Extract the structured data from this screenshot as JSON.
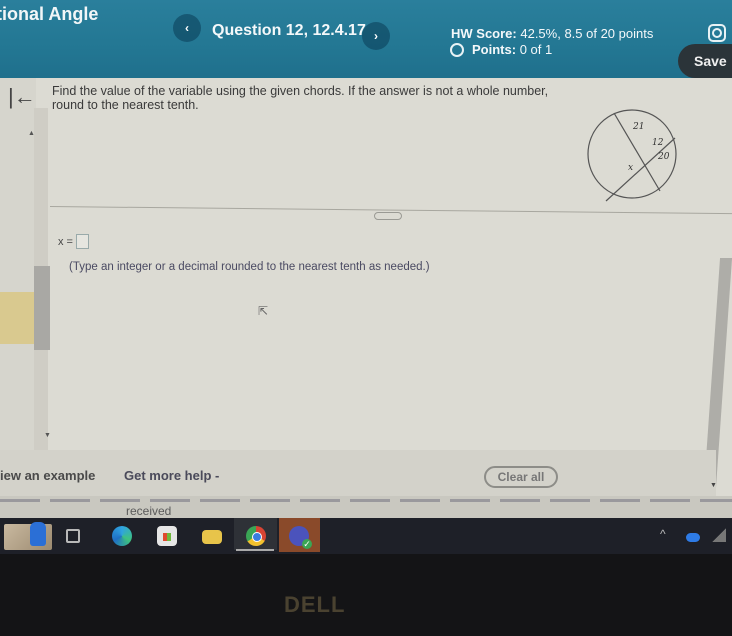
{
  "header": {
    "assignment_title": "tional Angle",
    "question_label": "Question 12, 12.4.17",
    "prev_icon": "chevron-left-icon",
    "next_icon": "chevron-right-icon",
    "hw_score_label": "HW Score:",
    "hw_score_value": "42.5%, 8.5 of 20 points",
    "points_label": "Points:",
    "points_value": "0 of 1",
    "settings_icon": "gear-icon",
    "save_label": "Save",
    "prev_glyph": "‹",
    "next_glyph": "›"
  },
  "question": {
    "collapse_glyph": "|←",
    "prompt": "Find the value of the variable using the given chords. If the answer is not a whole number, round to the nearest tenth.",
    "diagram": {
      "labels": [
        "21",
        "12",
        "20",
        "x"
      ]
    },
    "answer_prefix": "x =",
    "answer_value": "",
    "hint": "(Type an integer or a decimal rounded to the nearest tenth as needed.)"
  },
  "footer": {
    "view_example": "iew an example",
    "get_more_help": "Get more help -",
    "clear_all": "Clear all"
  },
  "background": {
    "partial_text": "received"
  },
  "taskbar": {
    "icons": [
      "widgets-icon",
      "task-view-icon",
      "edge-icon",
      "store-icon",
      "file-explorer-icon",
      "chrome-icon",
      "teams-icon"
    ],
    "tray": [
      "show-hidden-icons-chevron",
      "onedrive-icon",
      "wifi-icon"
    ],
    "tray_chevron_glyph": "^"
  },
  "bezel": {
    "brand": "DELL"
  },
  "colors": {
    "header_bg": "#237793",
    "save_button_bg": "#2b3439",
    "content_bg": "#dcdbd3",
    "taskbar_bg": "#1e2028"
  }
}
